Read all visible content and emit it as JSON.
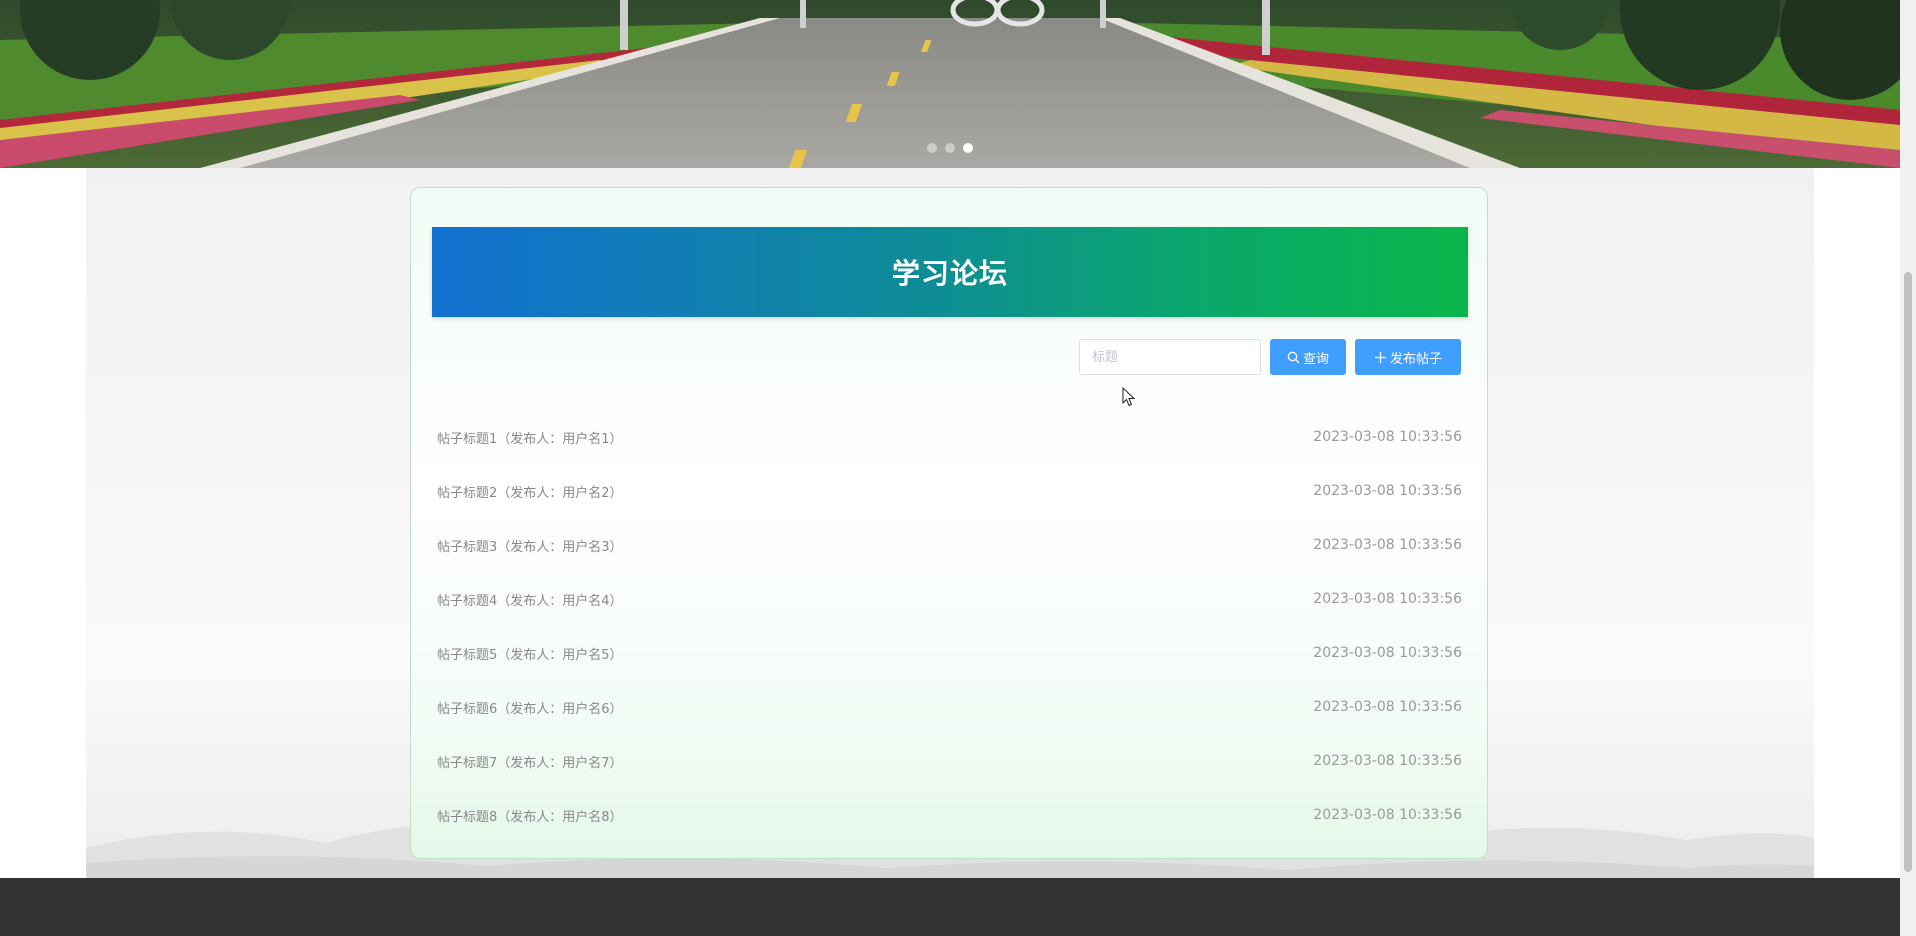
{
  "carousel": {
    "slide_count": 3,
    "active_index": 2
  },
  "forum": {
    "title": "学习论坛",
    "search_placeholder": "标题",
    "search_value": "",
    "search_button_label": "查询",
    "search_icon": "search-icon",
    "post_button_label": "发布帖子",
    "post_icon": "plus-icon"
  },
  "posts": [
    {
      "title": "帖子标题1（发布人：用户名1）",
      "time": "2023-03-08 10:33:56"
    },
    {
      "title": "帖子标题2（发布人：用户名2）",
      "time": "2023-03-08 10:33:56"
    },
    {
      "title": "帖子标题3（发布人：用户名3）",
      "time": "2023-03-08 10:33:56"
    },
    {
      "title": "帖子标题4（发布人：用户名4）",
      "time": "2023-03-08 10:33:56"
    },
    {
      "title": "帖子标题5（发布人：用户名5）",
      "time": "2023-03-08 10:33:56"
    },
    {
      "title": "帖子标题6（发布人：用户名6）",
      "time": "2023-03-08 10:33:56"
    },
    {
      "title": "帖子标题7（发布人：用户名7）",
      "time": "2023-03-08 10:33:56"
    },
    {
      "title": "帖子标题8（发布人：用户名8）",
      "time": "2023-03-08 10:33:56"
    }
  ],
  "colors": {
    "primary_button": "#409eff",
    "title_gradient_start": "#1170d1",
    "title_gradient_end": "#0bb54a",
    "card_border": "#b9e3c6",
    "footer": "#333333"
  }
}
